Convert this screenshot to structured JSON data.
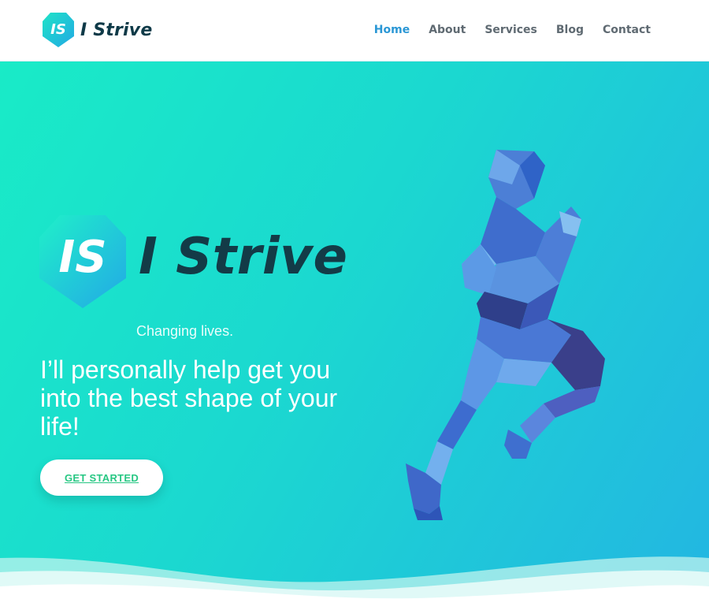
{
  "header": {
    "logo_text": "I Strive",
    "logo_monogram": "IS",
    "nav": [
      {
        "label": "Home",
        "active": true
      },
      {
        "label": "About",
        "active": false
      },
      {
        "label": "Services",
        "active": false
      },
      {
        "label": "Blog",
        "active": false
      },
      {
        "label": "Contact",
        "active": false
      }
    ]
  },
  "hero": {
    "logo_text": "I Strive",
    "logo_monogram": "IS",
    "tagline": "Changing lives.",
    "headline": "I’ll personally help get you into the best shape of your life!",
    "cta_label": "GET STARTED",
    "image_icon": "polygon-runner-illustration"
  },
  "colors": {
    "accent": "#2a97d5",
    "hero_gradient_start": "#19ebc7",
    "hero_gradient_end": "#23b6e2",
    "cta_text": "#27c783"
  }
}
